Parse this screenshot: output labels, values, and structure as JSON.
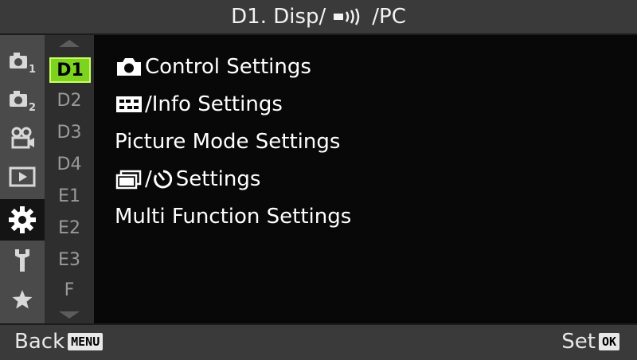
{
  "header": {
    "title_prefix": "D1. Disp/",
    "title_suffix": "/PC",
    "wireless_icon": "wifi-signal-icon"
  },
  "sidebar_icons": [
    {
      "name": "camera1-menu-icon",
      "label": "1"
    },
    {
      "name": "camera2-menu-icon",
      "label": "2"
    },
    {
      "name": "video-menu-icon"
    },
    {
      "name": "playback-menu-icon"
    },
    {
      "name": "custom-menu-gear-icon",
      "active": true
    },
    {
      "name": "setup-menu-wrench-icon"
    },
    {
      "name": "my-menu-star-icon"
    }
  ],
  "tabs": [
    "D1",
    "D2",
    "D3",
    "D4",
    "E1",
    "E2",
    "E3",
    "F"
  ],
  "active_tab": "D1",
  "menu": {
    "items": [
      {
        "label": "Control Settings",
        "icon": "camera-icon"
      },
      {
        "label": "/Info Settings",
        "icon": "info-display-icon"
      },
      {
        "label": "Picture Mode Settings"
      },
      {
        "label": "/",
        "icon": "drive-mode-icon",
        "suffix": "Settings",
        "suffix_icon": "self-timer-icon"
      },
      {
        "label": "Multi Function Settings"
      }
    ]
  },
  "footer": {
    "back_label": "Back",
    "back_key": "MENU",
    "set_label": "Set",
    "set_key": "OK"
  },
  "colors": {
    "accent": "#7ed321",
    "bar": "#3a3a3a",
    "background": "#0a0a0a"
  }
}
